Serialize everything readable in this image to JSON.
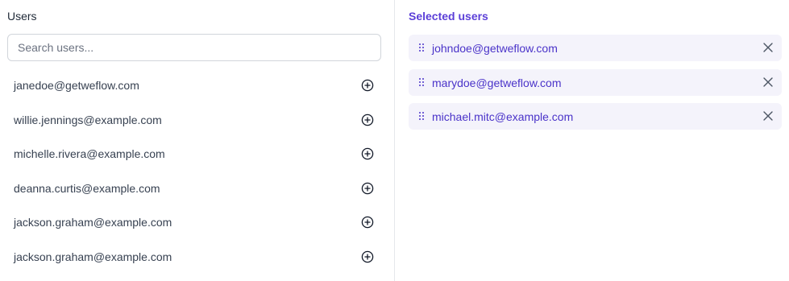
{
  "left_panel": {
    "title": "Users",
    "search_placeholder": "Search users...",
    "search_value": "",
    "users": [
      "janedoe@getweflow.com",
      "willie.jennings@example.com",
      "michelle.rivera@example.com",
      "deanna.curtis@example.com",
      "jackson.graham@example.com",
      "jackson.graham@example.com"
    ],
    "add_icon": "plus-circle-icon"
  },
  "right_panel": {
    "title": "Selected users",
    "selected": [
      "johndoe@getweflow.com",
      "marydoe@getweflow.com",
      "michael.mitc@example.com"
    ],
    "drag_icon": "drag-handle-icon",
    "remove_icon": "close-icon"
  },
  "colors": {
    "accent": "#5b3fd8",
    "selected_text": "#4a33c9",
    "selected_bg": "#f4f3fb",
    "border": "#e5e7eb"
  }
}
